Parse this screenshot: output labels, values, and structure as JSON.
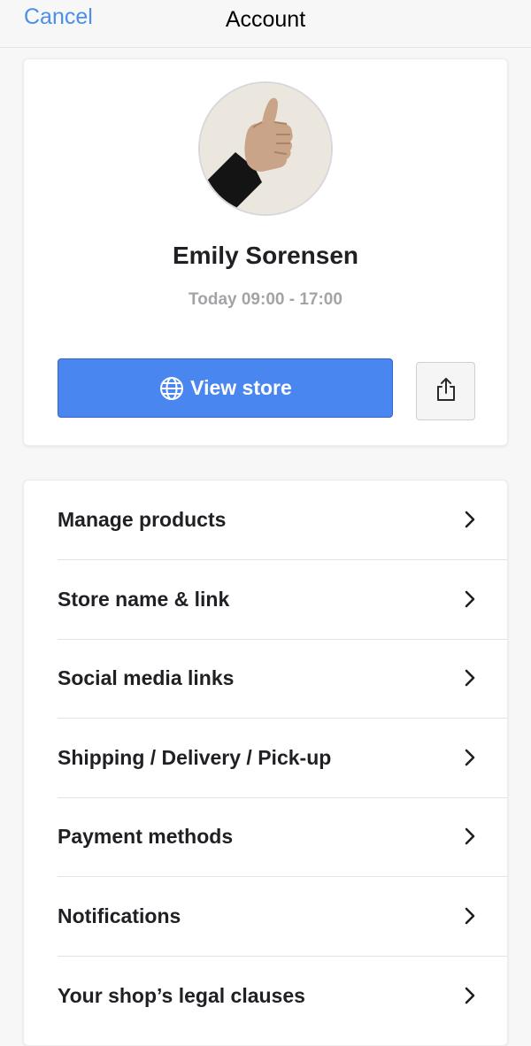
{
  "nav": {
    "cancel_label": "Cancel",
    "title": "Account"
  },
  "profile": {
    "name": "Emily Sorensen",
    "hours": "Today 09:00 - 17:00",
    "view_store_label": "View store",
    "avatar_icon": "avatar-photo",
    "share_icon": "share-icon",
    "globe_icon": "globe-icon"
  },
  "menu": {
    "items": [
      {
        "label": "Manage products"
      },
      {
        "label": "Store name & link"
      },
      {
        "label": "Social media links"
      },
      {
        "label": "Shipping / Delivery / Pick-up"
      },
      {
        "label": "Payment methods"
      },
      {
        "label": "Notifications"
      },
      {
        "label": "Your shop’s legal clauses"
      }
    ],
    "chevron_icon": "chevron-right-icon"
  },
  "colors": {
    "accent": "#4a8fe8",
    "button": "#4a86f0",
    "background": "#f7f7f7",
    "card": "#ffffff",
    "muted_text": "#a3a3a8"
  }
}
